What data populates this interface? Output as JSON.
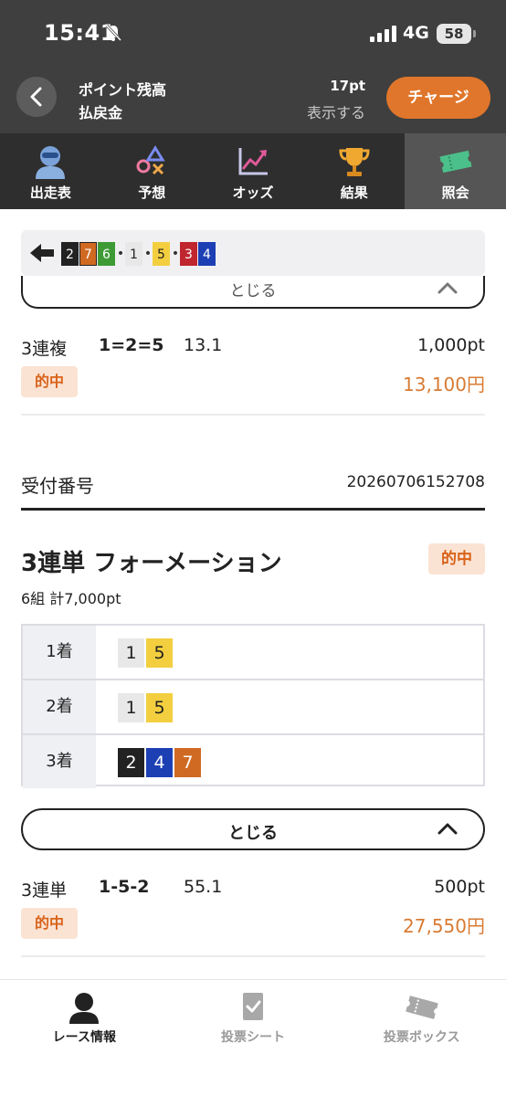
{
  "status_bar": {
    "time": "15:41",
    "network": "4G",
    "battery": "58"
  },
  "header": {
    "points_label": "ポイント残高",
    "refund_label": "払戻金",
    "points_value": "17pt",
    "show_label": "表示する",
    "charge_label": "チャージ"
  },
  "tabs": [
    {
      "label": "出走表",
      "icon": "racer-icon"
    },
    {
      "label": "予想",
      "icon": "prediction-icon"
    },
    {
      "label": "オッズ",
      "icon": "odds-chart-icon"
    },
    {
      "label": "結果",
      "icon": "trophy-icon"
    },
    {
      "label": "照会",
      "icon": "ticket-icon",
      "active": true
    }
  ],
  "top_strip": {
    "groups": [
      [
        "2",
        "7",
        "6"
      ],
      [
        "1"
      ],
      [
        "5"
      ],
      [
        "3",
        "4"
      ]
    ]
  },
  "close_label": "とじる",
  "bet1": {
    "type": "3連複",
    "combo": "1=2=5",
    "odds": "13.1",
    "amount": "1,000pt",
    "result": "的中",
    "payout": "13,100円"
  },
  "receipt": {
    "label": "受付番号",
    "number": "20260706152708"
  },
  "formation": {
    "title": "3連単 フォーメーション",
    "result": "的中",
    "summary": "6組 計7,000pt",
    "rows": [
      {
        "rank": "1着",
        "picks": [
          "1",
          "5"
        ]
      },
      {
        "rank": "2着",
        "picks": [
          "1",
          "5"
        ]
      },
      {
        "rank": "3着",
        "picks": [
          "2",
          "4",
          "7"
        ]
      }
    ]
  },
  "bet2": {
    "type": "3連単",
    "combo": "1-5-2",
    "odds": "55.1",
    "amount": "500pt",
    "result": "的中",
    "payout": "27,550円"
  },
  "bottom_nav": [
    {
      "label": "レース情報",
      "icon": "racer-icon",
      "active": true
    },
    {
      "label": "投票シート",
      "icon": "vote-sheet-icon"
    },
    {
      "label": "投票ボックス",
      "icon": "vote-box-icon"
    }
  ],
  "colors": {
    "boat_1": "#e8e8e8",
    "boat_2": "#222222",
    "boat_3": "#c0262d",
    "boat_4": "#1c3fb4",
    "boat_5": "#f3cf3f",
    "boat_6": "#3e9a35",
    "boat_7": "#d06a22",
    "accent": "#e0762b",
    "header_bg": "#3f3f3f"
  }
}
